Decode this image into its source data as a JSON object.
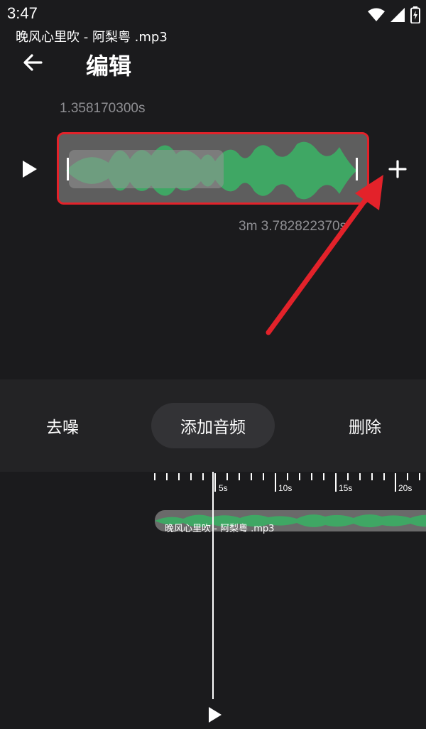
{
  "status_bar": {
    "time": "3:47",
    "icons": [
      "wifi-icon",
      "signal-icon",
      "battery-charging-icon"
    ]
  },
  "toolbar": {
    "back_icon": "arrow-left-icon",
    "title": "编辑"
  },
  "clip_editor": {
    "start_time": "1.358170300s",
    "end_time": "3m 3.782822370s",
    "file_name": "晚风心里吹 - 阿梨粤 .mp3",
    "play_icon": "play-icon",
    "add_icon": "plus-icon",
    "accent_color": "#e3222a",
    "wave_color": "#3fa764"
  },
  "actions": {
    "denoise": "去噪",
    "add_audio": "添加音频",
    "delete": "删除"
  },
  "timeline": {
    "tick_labels": [
      "5s",
      "10s",
      "15s",
      "20s"
    ],
    "track_label": "晚风心里吹 - 阿梨粤 .mp3"
  },
  "bottom": {
    "play_icon": "play-icon"
  }
}
